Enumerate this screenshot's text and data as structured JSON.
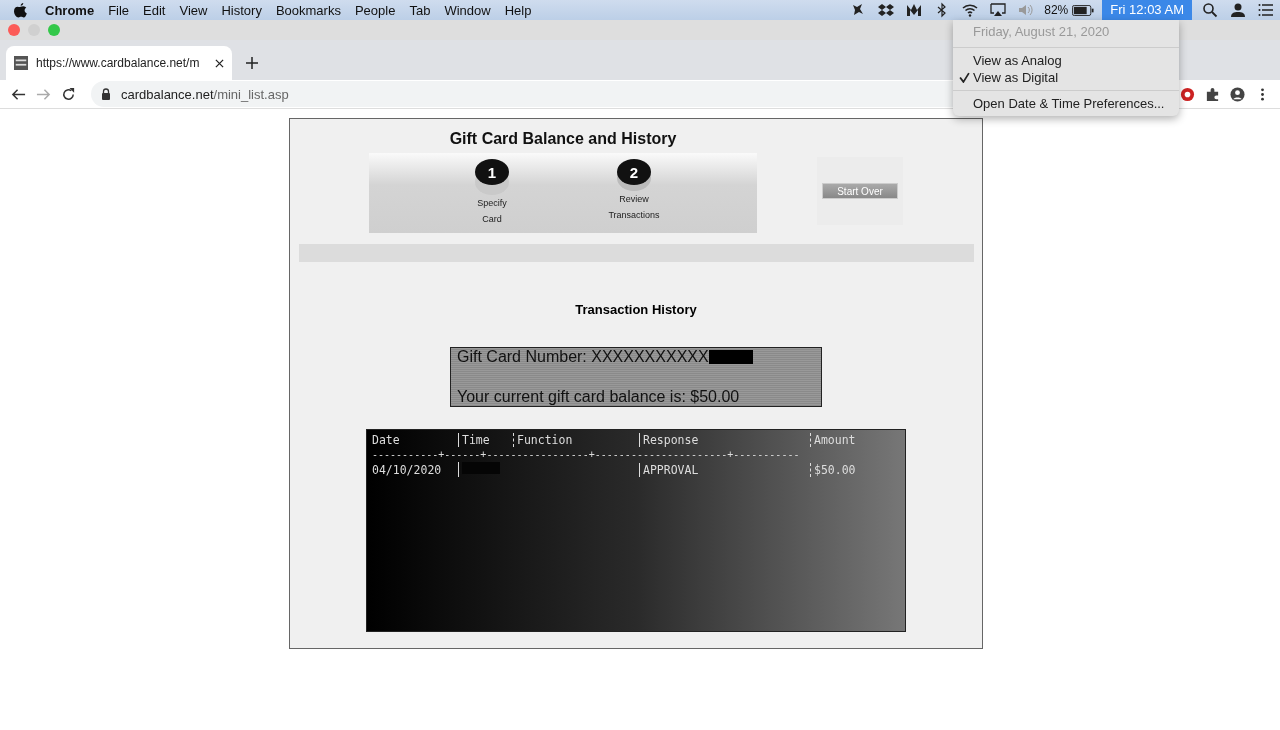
{
  "menu_bar": {
    "app": "Chrome",
    "items": [
      "File",
      "Edit",
      "View",
      "History",
      "Bookmarks",
      "People",
      "Tab",
      "Window",
      "Help"
    ],
    "battery": "82%",
    "clock": "Fri 12:03 AM"
  },
  "clock_menu": {
    "date": "Friday, August 21, 2020",
    "items": [
      {
        "label": "View as Analog",
        "checked": false
      },
      {
        "label": "View as Digital",
        "checked": true
      }
    ],
    "preferences": "Open Date & Time Preferences..."
  },
  "tabs": [
    {
      "title": "https://www.cardbalance.net/m",
      "selected": true
    }
  ],
  "address_bar": {
    "host": "cardbalance.net",
    "path": "/mini_list.asp"
  },
  "page": {
    "title": "Gift Card Balance and History",
    "steps": [
      {
        "number": "1",
        "label_1": "Specify",
        "label_2": "Card",
        "selected": true
      },
      {
        "number": "2",
        "label_1": "Review",
        "label_2": "Transactions",
        "selected": false
      }
    ],
    "start_over": "Start Over",
    "section_title": "Transaction History",
    "card_number": "Gift Card Number: XXXXXXXXXXX",
    "balance": "Your current gift card balance is: $50.00",
    "table": {
      "columns": [
        "Date",
        "Time",
        "Function",
        "Response",
        "Amount"
      ],
      "separator": "-----------+------+-----------------+----------------------+-----------",
      "rows": [
        {
          "date": "04/10/2020",
          "time_redacted": true,
          "function": "",
          "response": "APPROVAL",
          "amount": "$50.00"
        }
      ]
    }
  }
}
